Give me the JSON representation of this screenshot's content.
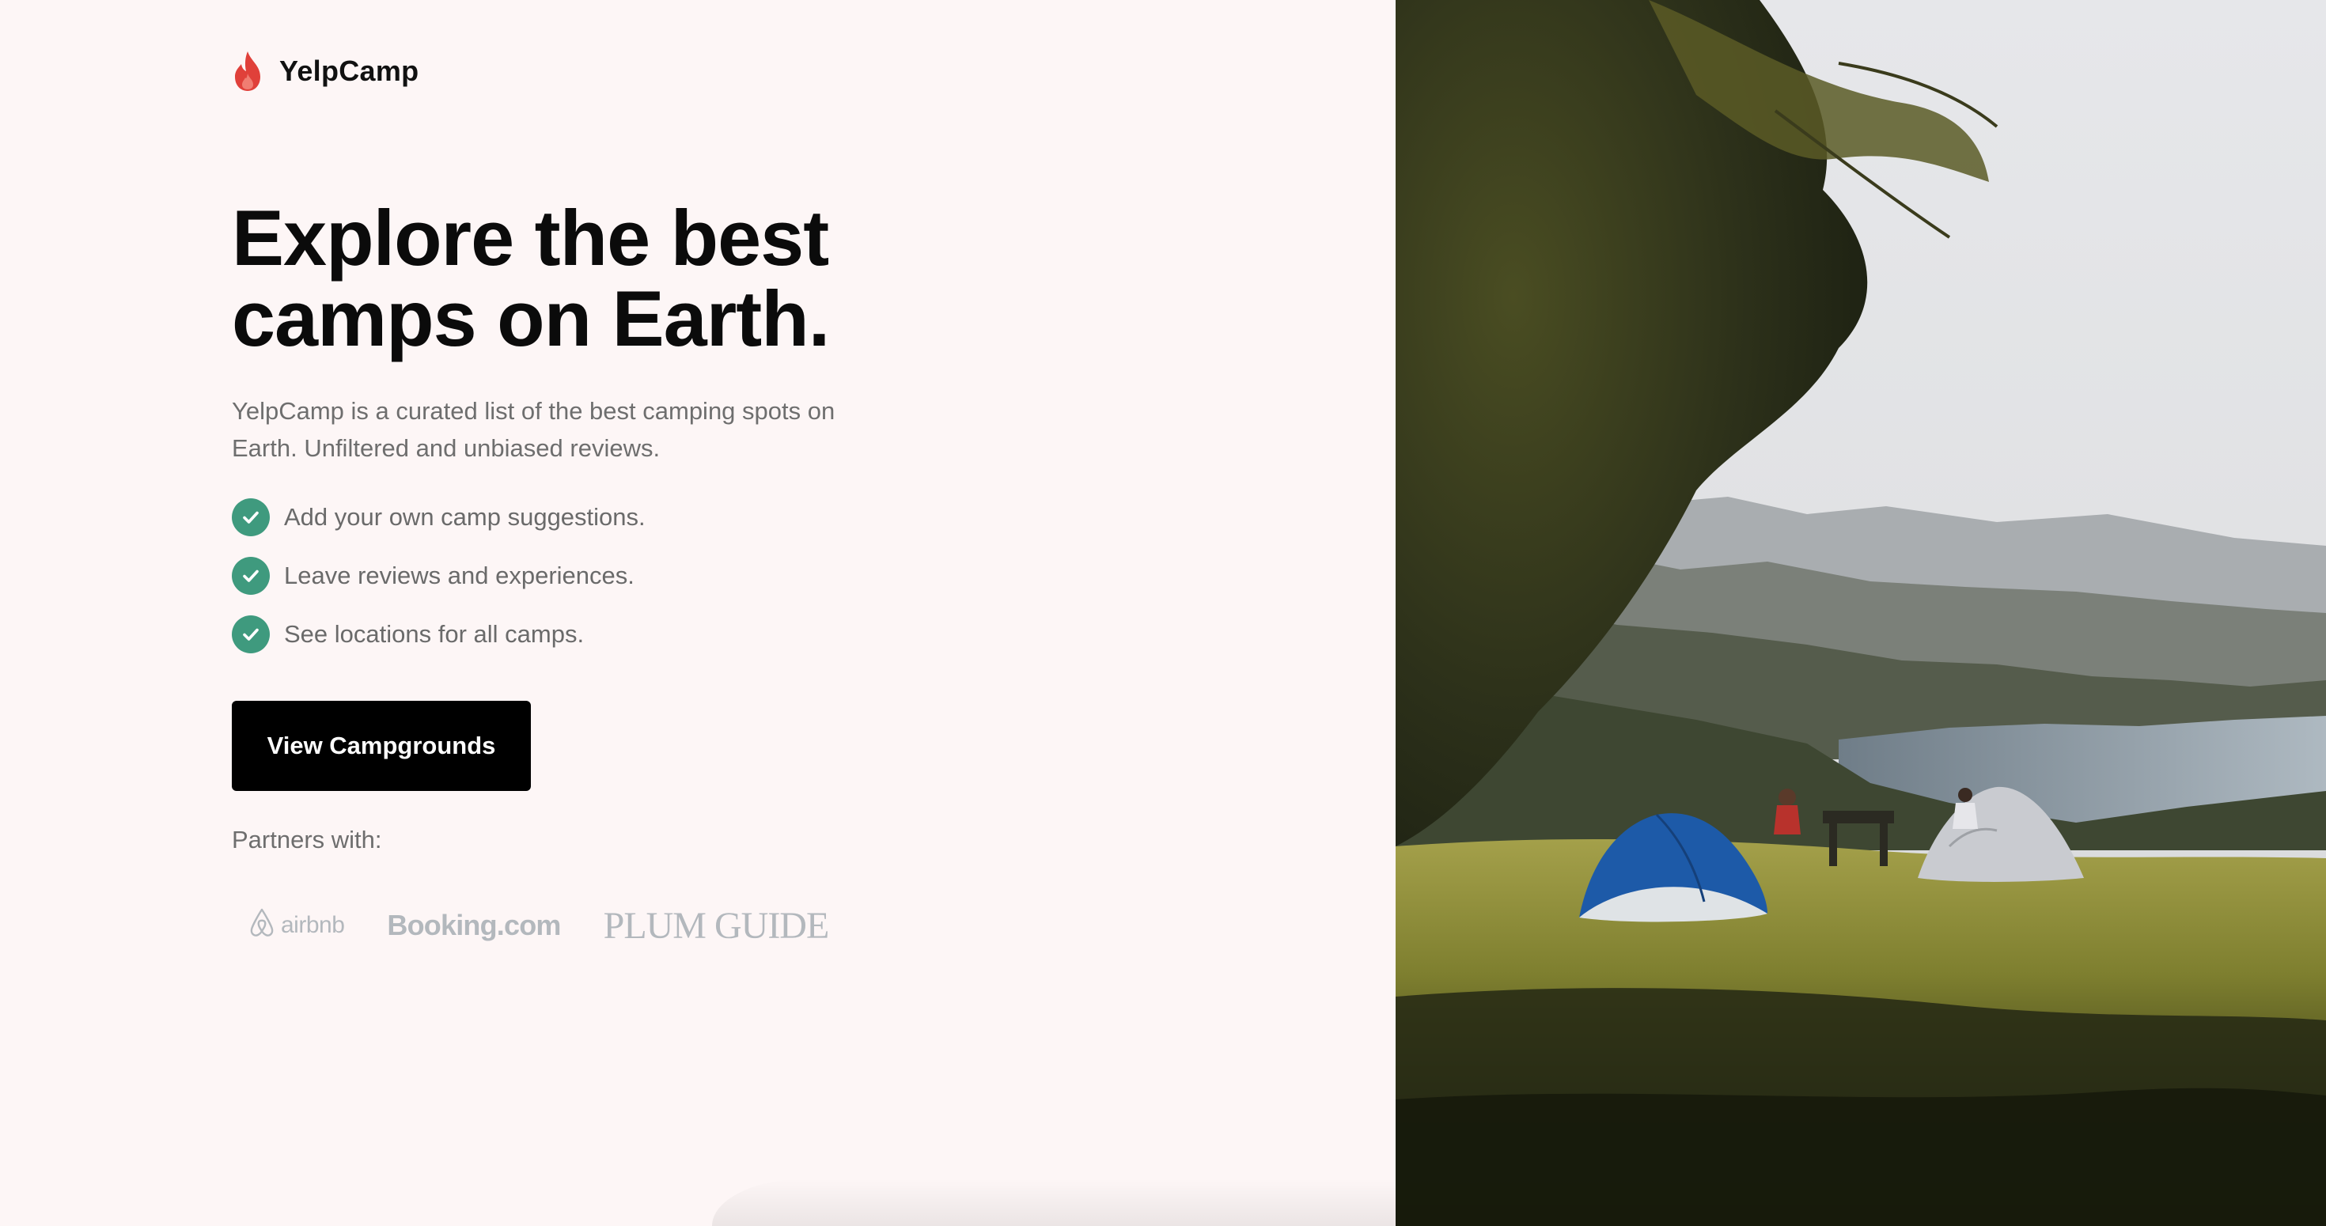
{
  "brand": {
    "name": "YelpCamp",
    "logo_icon": "flame-icon",
    "logo_color": "#e0403a"
  },
  "hero": {
    "title_line1": "Explore the best",
    "title_line2": "camps on Earth.",
    "description": "YelpCamp is a curated list of the best camping spots on Earth. Unfiltered and unbiased reviews."
  },
  "features": [
    {
      "text": "Add your own camp suggestions.",
      "icon": "check-circle-icon"
    },
    {
      "text": "Leave reviews and experiences.",
      "icon": "check-circle-icon"
    },
    {
      "text": "See locations for all camps.",
      "icon": "check-circle-icon"
    }
  ],
  "cta": {
    "label": "View Campgrounds"
  },
  "partners": {
    "label": "Partners with:",
    "logos": [
      "airbnb",
      "Booking.com",
      "PLUM GUIDE"
    ]
  },
  "colors": {
    "background": "#fdf6f6",
    "accent_check": "#3f9a7e",
    "button": "#000000",
    "partner_logo": "#b3b8bd"
  }
}
